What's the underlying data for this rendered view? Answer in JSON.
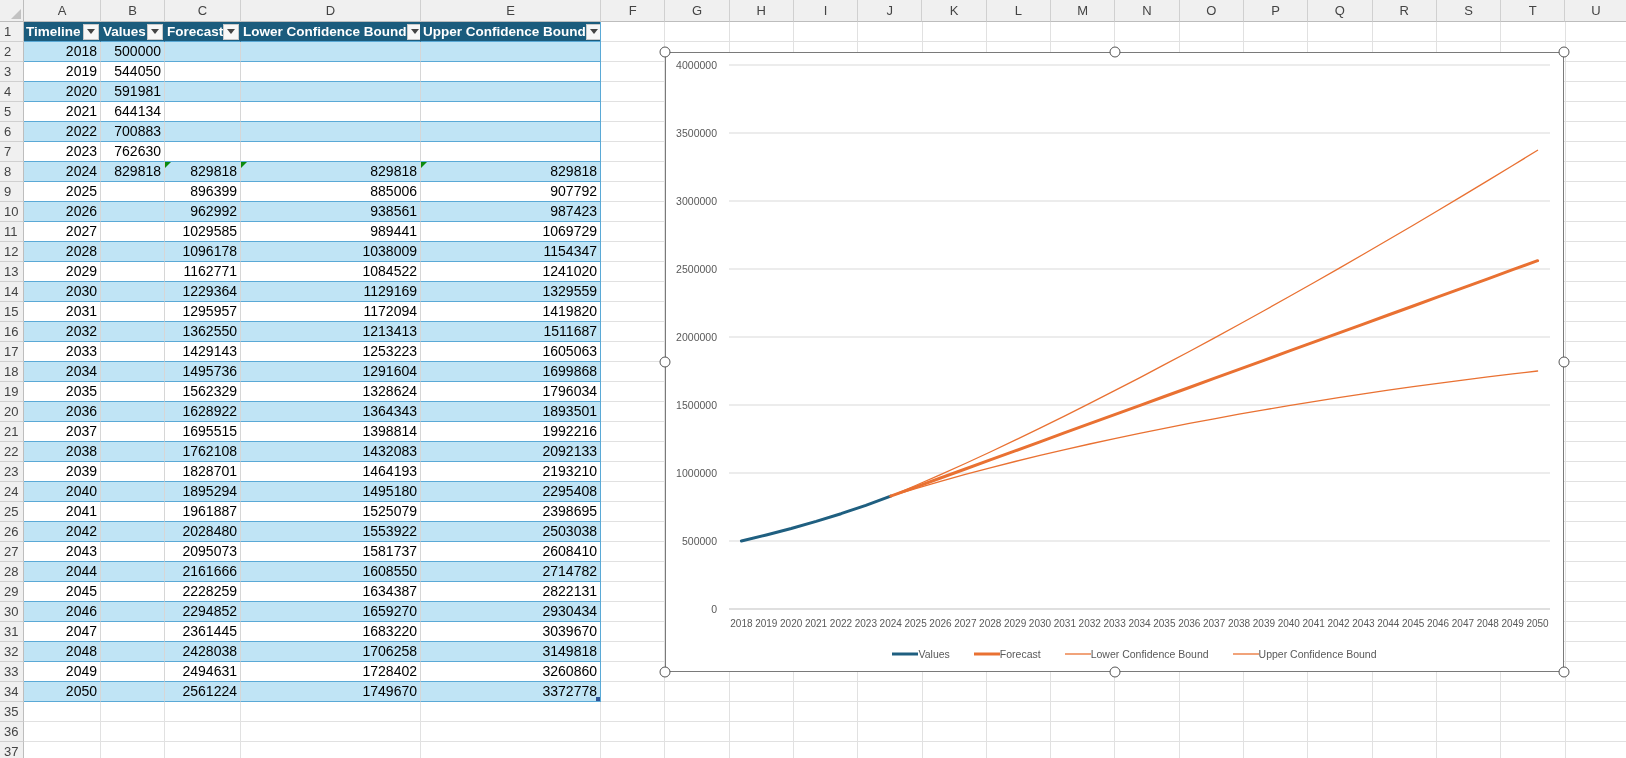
{
  "sheet": {
    "columns": [
      "A",
      "B",
      "C",
      "D",
      "E",
      "F",
      "G",
      "H",
      "I",
      "J",
      "K",
      "L",
      "M",
      "N",
      "O",
      "P",
      "Q",
      "R",
      "S",
      "T",
      "U"
    ],
    "table": {
      "header_row": "1",
      "headers": [
        "Timeline",
        "Values",
        "Forecast",
        "Lower Confidence Bound",
        "Upper Confidence Bound"
      ],
      "rows": [
        {
          "n": "2",
          "cells": [
            "2018",
            "500000",
            null,
            null,
            null
          ],
          "flags": [
            false,
            false,
            false,
            false,
            false
          ]
        },
        {
          "n": "3",
          "cells": [
            "2019",
            "544050",
            null,
            null,
            null
          ],
          "flags": [
            false,
            false,
            false,
            false,
            false
          ]
        },
        {
          "n": "4",
          "cells": [
            "2020",
            "591981",
            null,
            null,
            null
          ],
          "flags": [
            false,
            false,
            false,
            false,
            false
          ]
        },
        {
          "n": "5",
          "cells": [
            "2021",
            "644134",
            null,
            null,
            null
          ],
          "flags": [
            false,
            false,
            false,
            false,
            false
          ]
        },
        {
          "n": "6",
          "cells": [
            "2022",
            "700883",
            null,
            null,
            null
          ],
          "flags": [
            false,
            false,
            false,
            false,
            false
          ]
        },
        {
          "n": "7",
          "cells": [
            "2023",
            "762630",
            null,
            null,
            null
          ],
          "flags": [
            false,
            false,
            false,
            false,
            false
          ]
        },
        {
          "n": "8",
          "cells": [
            "2024",
            "829818",
            "829818",
            "829818",
            "829818"
          ],
          "flags": [
            false,
            false,
            true,
            true,
            true
          ]
        },
        {
          "n": "9",
          "cells": [
            "2025",
            null,
            "896399",
            "885006",
            "907792"
          ],
          "flags": [
            false,
            false,
            false,
            false,
            false
          ]
        },
        {
          "n": "10",
          "cells": [
            "2026",
            null,
            "962992",
            "938561",
            "987423"
          ],
          "flags": [
            false,
            false,
            false,
            false,
            false
          ]
        },
        {
          "n": "11",
          "cells": [
            "2027",
            null,
            "1029585",
            "989441",
            "1069729"
          ],
          "flags": [
            false,
            false,
            false,
            false,
            false
          ]
        },
        {
          "n": "12",
          "cells": [
            "2028",
            null,
            "1096178",
            "1038009",
            "1154347"
          ],
          "flags": [
            false,
            false,
            false,
            false,
            false
          ]
        },
        {
          "n": "13",
          "cells": [
            "2029",
            null,
            "1162771",
            "1084522",
            "1241020"
          ],
          "flags": [
            false,
            false,
            false,
            false,
            false
          ]
        },
        {
          "n": "14",
          "cells": [
            "2030",
            null,
            "1229364",
            "1129169",
            "1329559"
          ],
          "flags": [
            false,
            false,
            false,
            false,
            false
          ]
        },
        {
          "n": "15",
          "cells": [
            "2031",
            null,
            "1295957",
            "1172094",
            "1419820"
          ],
          "flags": [
            false,
            false,
            false,
            false,
            false
          ]
        },
        {
          "n": "16",
          "cells": [
            "2032",
            null,
            "1362550",
            "1213413",
            "1511687"
          ],
          "flags": [
            false,
            false,
            false,
            false,
            false
          ]
        },
        {
          "n": "17",
          "cells": [
            "2033",
            null,
            "1429143",
            "1253223",
            "1605063"
          ],
          "flags": [
            false,
            false,
            false,
            false,
            false
          ]
        },
        {
          "n": "18",
          "cells": [
            "2034",
            null,
            "1495736",
            "1291604",
            "1699868"
          ],
          "flags": [
            false,
            false,
            false,
            false,
            false
          ]
        },
        {
          "n": "19",
          "cells": [
            "2035",
            null,
            "1562329",
            "1328624",
            "1796034"
          ],
          "flags": [
            false,
            false,
            false,
            false,
            false
          ]
        },
        {
          "n": "20",
          "cells": [
            "2036",
            null,
            "1628922",
            "1364343",
            "1893501"
          ],
          "flags": [
            false,
            false,
            false,
            false,
            false
          ]
        },
        {
          "n": "21",
          "cells": [
            "2037",
            null,
            "1695515",
            "1398814",
            "1992216"
          ],
          "flags": [
            false,
            false,
            false,
            false,
            false
          ]
        },
        {
          "n": "22",
          "cells": [
            "2038",
            null,
            "1762108",
            "1432083",
            "2092133"
          ],
          "flags": [
            false,
            false,
            false,
            false,
            false
          ]
        },
        {
          "n": "23",
          "cells": [
            "2039",
            null,
            "1828701",
            "1464193",
            "2193210"
          ],
          "flags": [
            false,
            false,
            false,
            false,
            false
          ]
        },
        {
          "n": "24",
          "cells": [
            "2040",
            null,
            "1895294",
            "1495180",
            "2295408"
          ],
          "flags": [
            false,
            false,
            false,
            false,
            false
          ]
        },
        {
          "n": "25",
          "cells": [
            "2041",
            null,
            "1961887",
            "1525079",
            "2398695"
          ],
          "flags": [
            false,
            false,
            false,
            false,
            false
          ]
        },
        {
          "n": "26",
          "cells": [
            "2042",
            null,
            "2028480",
            "1553922",
            "2503038"
          ],
          "flags": [
            false,
            false,
            false,
            false,
            false
          ]
        },
        {
          "n": "27",
          "cells": [
            "2043",
            null,
            "2095073",
            "1581737",
            "2608410"
          ],
          "flags": [
            false,
            false,
            false,
            false,
            false
          ]
        },
        {
          "n": "28",
          "cells": [
            "2044",
            null,
            "2161666",
            "1608550",
            "2714782"
          ],
          "flags": [
            false,
            false,
            false,
            false,
            false
          ]
        },
        {
          "n": "29",
          "cells": [
            "2045",
            null,
            "2228259",
            "1634387",
            "2822131"
          ],
          "flags": [
            false,
            false,
            false,
            false,
            false
          ]
        },
        {
          "n": "30",
          "cells": [
            "2046",
            null,
            "2294852",
            "1659270",
            "2930434"
          ],
          "flags": [
            false,
            false,
            false,
            false,
            false
          ]
        },
        {
          "n": "31",
          "cells": [
            "2047",
            null,
            "2361445",
            "1683220",
            "3039670"
          ],
          "flags": [
            false,
            false,
            false,
            false,
            false
          ]
        },
        {
          "n": "32",
          "cells": [
            "2048",
            null,
            "2428038",
            "1706258",
            "3149818"
          ],
          "flags": [
            false,
            false,
            false,
            false,
            false
          ]
        },
        {
          "n": "33",
          "cells": [
            "2049",
            null,
            "2494631",
            "1728402",
            "3260860"
          ],
          "flags": [
            false,
            false,
            false,
            false,
            false
          ]
        },
        {
          "n": "34",
          "cells": [
            "2050",
            null,
            "2561224",
            "1749670",
            "3372778"
          ],
          "flags": [
            false,
            false,
            false,
            false,
            false
          ]
        }
      ]
    },
    "extra_rows": [
      "35",
      "36",
      "37"
    ]
  },
  "chart": {
    "selected": true,
    "chart_data": {
      "type": "line",
      "categories": [
        "2018",
        "2019",
        "2020",
        "2021",
        "2022",
        "2023",
        "2024",
        "2025",
        "2026",
        "2027",
        "2028",
        "2029",
        "2030",
        "2031",
        "2032",
        "2033",
        "2034",
        "2035",
        "2036",
        "2037",
        "2038",
        "2039",
        "2040",
        "2041",
        "2042",
        "2043",
        "2044",
        "2045",
        "2046",
        "2047",
        "2048",
        "2049",
        "2050"
      ],
      "grid": true,
      "legend": true,
      "ylim": [
        0,
        4000000
      ],
      "yticks": [
        0,
        500000,
        1000000,
        1500000,
        2000000,
        2500000,
        3000000,
        3500000,
        4000000
      ],
      "series": [
        {
          "name": "Values",
          "color": "#1f5f80",
          "values": [
            500000,
            544050,
            591981,
            644134,
            700883,
            762630,
            829818,
            null,
            null,
            null,
            null,
            null,
            null,
            null,
            null,
            null,
            null,
            null,
            null,
            null,
            null,
            null,
            null,
            null,
            null,
            null,
            null,
            null,
            null,
            null,
            null,
            null,
            null
          ]
        },
        {
          "name": "Forecast",
          "color": "#e97132",
          "values": [
            null,
            null,
            null,
            null,
            null,
            null,
            829818,
            896399,
            962992,
            1029585,
            1096178,
            1162771,
            1229364,
            1295957,
            1362550,
            1429143,
            1495736,
            1562329,
            1628922,
            1695515,
            1762108,
            1828701,
            1895294,
            1961887,
            2028480,
            2095073,
            2161666,
            2228259,
            2294852,
            2361445,
            2428038,
            2494631,
            2561224
          ]
        },
        {
          "name": "Lower Confidence Bound",
          "color": "#e97132",
          "values": [
            null,
            null,
            null,
            null,
            null,
            null,
            829818,
            885006,
            938561,
            989441,
            1038009,
            1084522,
            1129169,
            1172094,
            1213413,
            1253223,
            1291604,
            1328624,
            1364343,
            1398814,
            1432083,
            1464193,
            1495180,
            1525079,
            1553922,
            1581737,
            1608550,
            1634387,
            1659270,
            1683220,
            1706258,
            1728402,
            1749670
          ]
        },
        {
          "name": "Upper Confidence Bound",
          "color": "#e97132",
          "values": [
            null,
            null,
            null,
            null,
            null,
            null,
            829818,
            907792,
            987423,
            1069729,
            1154347,
            1241020,
            1329559,
            1419820,
            1511687,
            1605063,
            1699868,
            1796034,
            1893501,
            1992216,
            2092133,
            2193210,
            2295408,
            2398695,
            2503038,
            2608410,
            2714782,
            2822131,
            2930434,
            3039670,
            3149818,
            3260860,
            3372778
          ]
        }
      ]
    }
  }
}
